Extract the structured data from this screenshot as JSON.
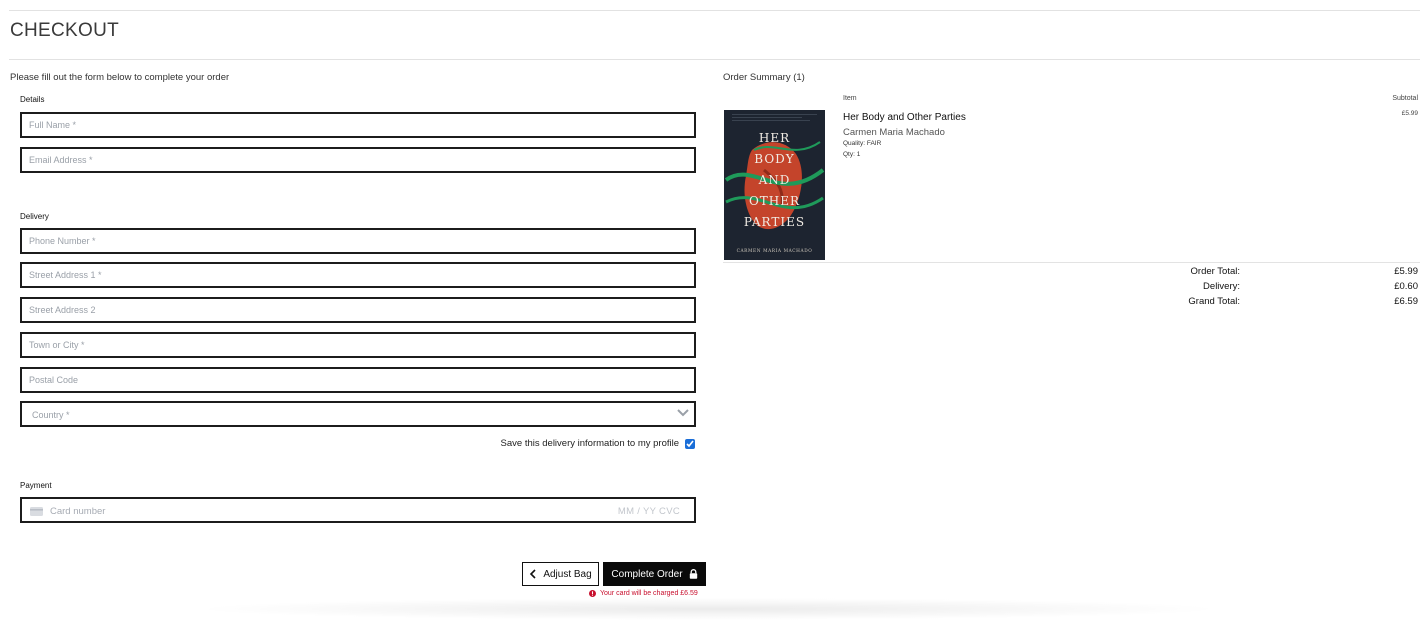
{
  "page": {
    "title": "CHECKOUT",
    "intro": "Please fill out the form below to complete your order"
  },
  "form": {
    "details_label": "Details",
    "full_name_placeholder": "Full Name *",
    "email_placeholder": "Email Address *",
    "delivery_label": "Delivery",
    "phone_placeholder": "Phone Number *",
    "street1_placeholder": "Street Address 1 *",
    "street2_placeholder": "Street Address 2",
    "town_placeholder": "Town or City *",
    "postcode_placeholder": "Postal Code",
    "country_placeholder": "Country *",
    "save_info_label": "Save this delivery information to my profile",
    "save_info_checked": true,
    "payment_label": "Payment",
    "card_placeholder": "Card number",
    "card_extra": "MM / YY  CVC"
  },
  "actions": {
    "adjust_label": "Adjust Bag",
    "complete_label": "Complete Order",
    "charge_note": "Your card will be charged £6.59"
  },
  "summary": {
    "title": "Order Summary (1)",
    "item_header": "Item",
    "subtotal_header": "Subtotal",
    "item": {
      "title": "Her Body and Other Parties",
      "author": "Carmen Maria Machado",
      "quality": "Quality: FAIR",
      "qty": "Qty: 1",
      "subtotal": "£5.99",
      "cover_title_lines": [
        "HER",
        "BODY",
        "AND",
        "OTHER",
        "PARTIES"
      ],
      "cover_author": "CARMEN MARIA MACHADO"
    },
    "totals": {
      "order_total_label": "Order Total:",
      "order_total": "£5.99",
      "delivery_label": "Delivery:",
      "delivery": "£0.60",
      "grand_total_label": "Grand Total:",
      "grand_total": "£6.59"
    }
  },
  "colors": {
    "accent": "#0a0a0a",
    "error": "#c8102e",
    "cover_bg": "#1d2430",
    "cover_red": "#c4442b",
    "cover_green": "#1f9a5a"
  }
}
